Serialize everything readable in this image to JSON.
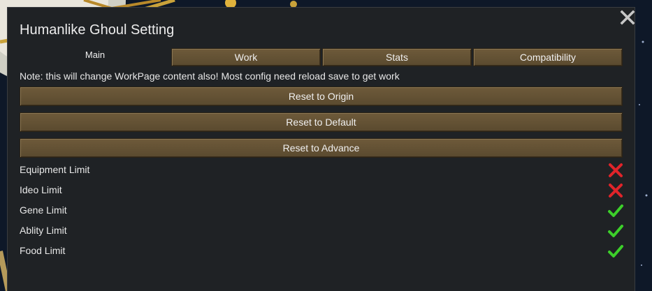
{
  "window": {
    "title": "Humanlike Ghoul Setting"
  },
  "tabs": [
    {
      "label": "Main",
      "active": true
    },
    {
      "label": "Work",
      "active": false
    },
    {
      "label": "Stats",
      "active": false
    },
    {
      "label": "Compatibility",
      "active": false
    }
  ],
  "note": "Note: this will change WorkPage content also! Most config need reload save to get work",
  "buttons": {
    "reset_origin": "Reset to Origin",
    "reset_default": "Reset to Default",
    "reset_advance": "Reset to Advance"
  },
  "settings": [
    {
      "label": "Equipment Limit",
      "enabled": false,
      "icon": "cross-icon"
    },
    {
      "label": "Ideo Limit",
      "enabled": false,
      "icon": "cross-icon"
    },
    {
      "label": "Gene Limit",
      "enabled": true,
      "icon": "check-icon"
    },
    {
      "label": "Ablity Limit",
      "enabled": true,
      "icon": "check-icon"
    },
    {
      "label": "Food Limit",
      "enabled": true,
      "icon": "check-icon"
    }
  ],
  "colors": {
    "cross": "#e0242a",
    "check": "#3ccf2a",
    "button": "#6e5a3a"
  }
}
